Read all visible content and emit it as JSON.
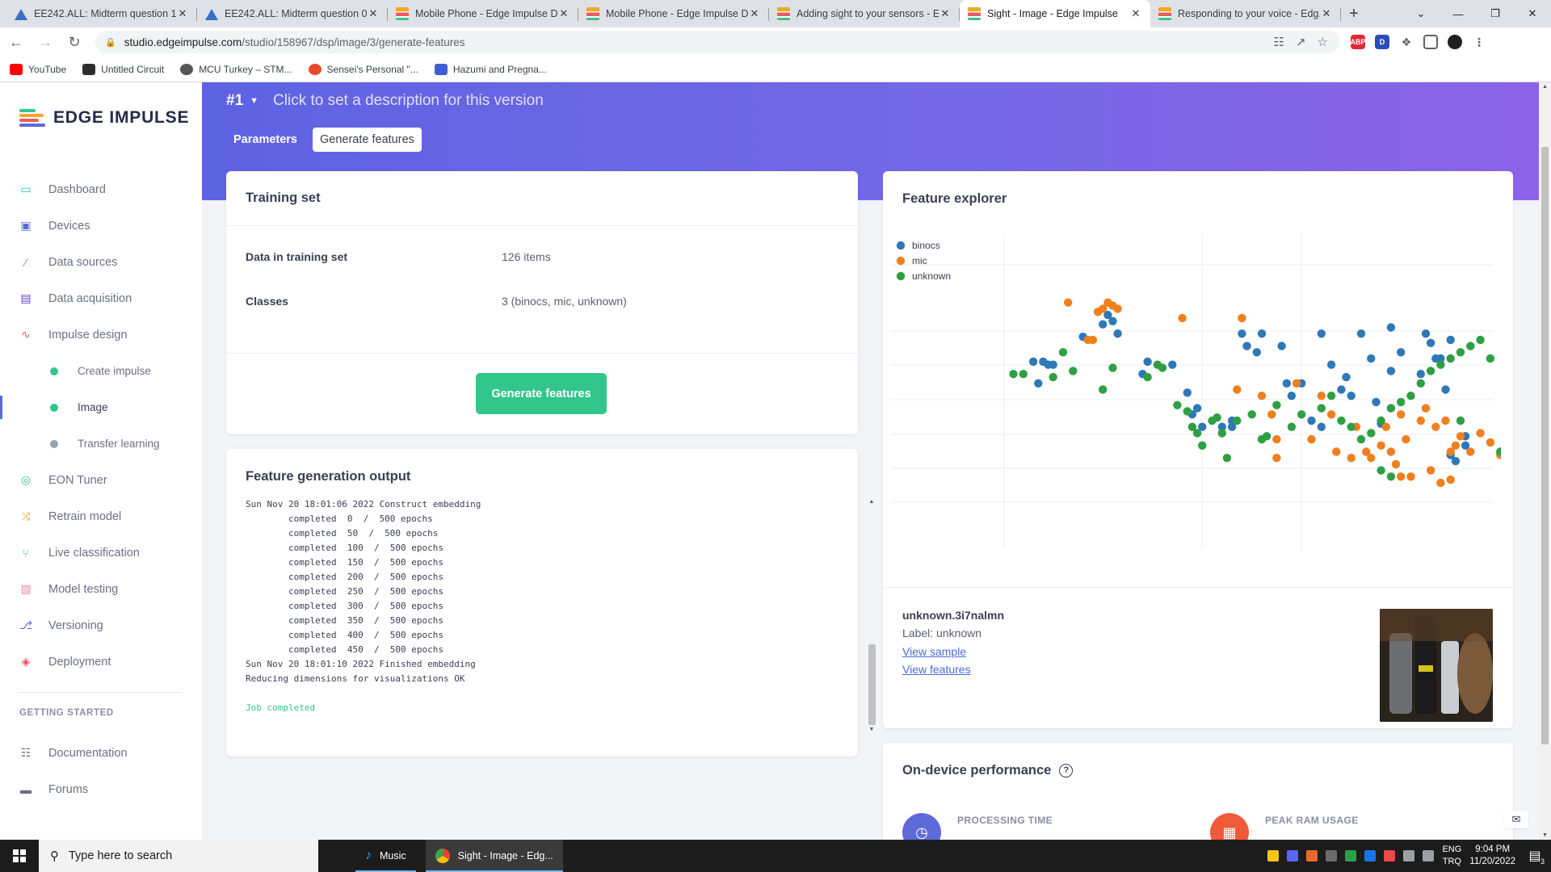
{
  "browser": {
    "tabs": [
      {
        "title": "EE242.ALL: Midterm question 1",
        "icon": "triangle-icon"
      },
      {
        "title": "EE242.ALL: Midterm question 0...",
        "icon": "triangle-icon"
      },
      {
        "title": "Mobile Phone - Edge Impulse D...",
        "icon": "edge-impulse-icon"
      },
      {
        "title": "Mobile Phone - Edge Impulse D...",
        "icon": "edge-impulse-icon"
      },
      {
        "title": "Adding sight to your sensors - E...",
        "icon": "edge-impulse-icon"
      },
      {
        "title": "Sight - Image - Edge Impulse",
        "icon": "edge-impulse-icon",
        "active": true
      },
      {
        "title": "Responding to your voice - Edg...",
        "icon": "edge-impulse-icon"
      }
    ],
    "url_host": "studio.edgeimpulse.com",
    "url_path": "/studio/158967/dsp/image/3/generate-features",
    "bookmarks": [
      "YouTube",
      "Untitled Circuit",
      "MCU Turkey – STM...",
      "Sensei's Personal \"...",
      "Hazumi and Pregna..."
    ]
  },
  "sidebar": {
    "logo": "EDGE IMPULSE",
    "items": [
      {
        "label": "Dashboard",
        "icon": "monitor-icon",
        "color": "#29b6d8"
      },
      {
        "label": "Devices",
        "icon": "chip-icon",
        "color": "#5c6bd8"
      },
      {
        "label": "Data sources",
        "icon": "wand-icon",
        "color": "#ef5a7a"
      },
      {
        "label": "Data acquisition",
        "icon": "database-icon",
        "color": "#5b3fc4"
      },
      {
        "label": "Impulse design",
        "icon": "pulse-icon",
        "color": "#ef5a5a"
      }
    ],
    "subitems": [
      {
        "label": "Create impulse",
        "color": "#32c68a"
      },
      {
        "label": "Image",
        "color": "#32c68a",
        "active": true
      },
      {
        "label": "Transfer learning",
        "color": "#9aa0ad"
      }
    ],
    "items2": [
      {
        "label": "EON Tuner",
        "icon": "target-icon",
        "color": "#32c68a"
      },
      {
        "label": "Retrain model",
        "icon": "shuffle-icon",
        "color": "#f5a623"
      },
      {
        "label": "Live classification",
        "icon": "tree-icon",
        "color": "#32c68a"
      },
      {
        "label": "Model testing",
        "icon": "clipboard-icon",
        "color": "#ef8a9a"
      },
      {
        "label": "Versioning",
        "icon": "branch-icon",
        "color": "#5c6bd8"
      },
      {
        "label": "Deployment",
        "icon": "box-icon",
        "color": "#ef4a5a"
      }
    ],
    "section_label": "GETTING STARTED",
    "bottom": [
      {
        "label": "Documentation",
        "icon": "book-icon"
      },
      {
        "label": "Forums",
        "icon": "chat-icon"
      }
    ]
  },
  "header": {
    "version": "#1",
    "description": "Click to set a description for this version",
    "tabs": [
      {
        "label": "Parameters",
        "active": false
      },
      {
        "label": "Generate features",
        "active": true
      }
    ]
  },
  "training_set": {
    "title": "Training set",
    "rows": [
      {
        "key": "Data in training set",
        "value": "126 items"
      },
      {
        "key": "Classes",
        "value": "3 (binocs, mic, unknown)"
      }
    ],
    "button": "Generate features"
  },
  "output": {
    "title": "Feature generation output",
    "lines": [
      "Sun Nov 20 18:01:06 2022 Construct embedding",
      "        completed  0  /  500 epochs",
      "        completed  50  /  500 epochs",
      "        completed  100  /  500 epochs",
      "        completed  150  /  500 epochs",
      "        completed  200  /  500 epochs",
      "        completed  250  /  500 epochs",
      "        completed  300  /  500 epochs",
      "        completed  350  /  500 epochs",
      "        completed  400  /  500 epochs",
      "        completed  450  /  500 epochs",
      "Sun Nov 20 18:01:10 2022 Finished embedding",
      "Reducing dimensions for visualizations OK",
      "",
      "Job completed"
    ]
  },
  "explorer": {
    "title": "Feature explorer",
    "sample_name": "unknown.3i7nalmn",
    "sample_label": "Label: unknown",
    "view_sample": "View sample",
    "view_features": "View features"
  },
  "chart_data": {
    "type": "scatter",
    "title": "",
    "xlabel": "",
    "ylabel": "",
    "grid": true,
    "legend": "top-left",
    "xlim": [
      0,
      100
    ],
    "ylim": [
      0,
      100
    ],
    "series": [
      {
        "name": "binocs",
        "color": "#2e78b7",
        "points": [
          [
            15,
            52
          ],
          [
            17,
            58
          ],
          [
            14,
            59
          ],
          [
            16,
            59
          ],
          [
            18,
            58
          ],
          [
            24,
            67
          ],
          [
            28,
            71
          ],
          [
            30,
            72
          ],
          [
            31,
            68
          ],
          [
            29,
            74
          ],
          [
            36,
            55
          ],
          [
            37,
            59
          ],
          [
            42,
            58
          ],
          [
            45,
            49
          ],
          [
            46,
            42
          ],
          [
            47,
            44
          ],
          [
            48,
            38
          ],
          [
            52,
            38
          ],
          [
            54,
            38
          ],
          [
            54,
            40
          ],
          [
            56,
            68
          ],
          [
            57,
            64
          ],
          [
            59,
            62
          ],
          [
            60,
            68
          ],
          [
            64,
            64
          ],
          [
            65,
            52
          ],
          [
            66,
            48
          ],
          [
            68,
            52
          ],
          [
            70,
            40
          ],
          [
            72,
            38
          ],
          [
            72,
            68
          ],
          [
            74,
            58
          ],
          [
            76,
            50
          ],
          [
            77,
            54
          ],
          [
            78,
            48
          ],
          [
            80,
            68
          ],
          [
            82,
            60
          ],
          [
            83,
            46
          ],
          [
            84,
            39
          ],
          [
            86,
            70
          ],
          [
            86,
            56
          ],
          [
            88,
            62
          ],
          [
            92,
            55
          ],
          [
            93,
            68
          ],
          [
            94,
            65
          ],
          [
            95,
            60
          ],
          [
            96,
            60
          ],
          [
            97,
            50
          ],
          [
            98,
            66
          ],
          [
            98,
            29
          ],
          [
            99,
            27
          ],
          [
            101,
            32
          ],
          [
            101,
            35
          ]
        ]
      },
      {
        "name": "mic",
        "color": "#f07f1e",
        "points": [
          [
            27,
            75
          ],
          [
            28,
            76
          ],
          [
            30,
            77
          ],
          [
            31,
            76
          ],
          [
            29,
            78
          ],
          [
            21,
            78
          ],
          [
            25,
            66
          ],
          [
            26,
            66
          ],
          [
            44,
            73
          ],
          [
            56,
            73
          ],
          [
            55,
            50
          ],
          [
            60,
            48
          ],
          [
            62,
            42
          ],
          [
            63,
            34
          ],
          [
            63,
            28
          ],
          [
            67,
            52
          ],
          [
            70,
            34
          ],
          [
            72,
            48
          ],
          [
            74,
            42
          ],
          [
            75,
            30
          ],
          [
            78,
            28
          ],
          [
            79,
            38
          ],
          [
            81,
            30
          ],
          [
            82,
            28
          ],
          [
            84,
            32
          ],
          [
            85,
            38
          ],
          [
            86,
            30
          ],
          [
            87,
            26
          ],
          [
            88,
            42
          ],
          [
            89,
            34
          ],
          [
            92,
            40
          ],
          [
            93,
            44
          ],
          [
            95,
            38
          ],
          [
            97,
            40
          ],
          [
            98,
            30
          ],
          [
            99,
            32
          ],
          [
            100,
            35
          ],
          [
            102,
            30
          ],
          [
            104,
            36
          ],
          [
            106,
            33
          ],
          [
            108,
            29
          ],
          [
            109,
            26
          ],
          [
            88,
            22
          ],
          [
            90,
            22
          ],
          [
            94,
            24
          ],
          [
            96,
            20
          ],
          [
            98,
            21
          ]
        ]
      },
      {
        "name": "unknown",
        "color": "#2ea043",
        "points": [
          [
            10,
            55
          ],
          [
            12,
            55
          ],
          [
            18,
            54
          ],
          [
            20,
            62
          ],
          [
            22,
            56
          ],
          [
            28,
            50
          ],
          [
            30,
            57
          ],
          [
            37,
            54
          ],
          [
            39,
            58
          ],
          [
            40,
            57
          ],
          [
            43,
            45
          ],
          [
            45,
            43
          ],
          [
            46,
            38
          ],
          [
            47,
            36
          ],
          [
            48,
            32
          ],
          [
            50,
            40
          ],
          [
            51,
            41
          ],
          [
            52,
            36
          ],
          [
            53,
            28
          ],
          [
            55,
            40
          ],
          [
            58,
            42
          ],
          [
            60,
            34
          ],
          [
            61,
            35
          ],
          [
            63,
            45
          ],
          [
            66,
            38
          ],
          [
            68,
            42
          ],
          [
            72,
            44
          ],
          [
            74,
            48
          ],
          [
            76,
            40
          ],
          [
            78,
            38
          ],
          [
            80,
            34
          ],
          [
            82,
            36
          ],
          [
            84,
            40
          ],
          [
            86,
            44
          ],
          [
            88,
            46
          ],
          [
            90,
            48
          ],
          [
            92,
            52
          ],
          [
            94,
            56
          ],
          [
            96,
            58
          ],
          [
            98,
            60
          ],
          [
            100,
            62
          ],
          [
            102,
            64
          ],
          [
            104,
            66
          ],
          [
            106,
            60
          ],
          [
            108,
            30
          ],
          [
            110,
            28
          ],
          [
            112,
            26
          ],
          [
            100,
            40
          ],
          [
            84,
            24
          ],
          [
            86,
            22
          ]
        ]
      }
    ]
  },
  "performance": {
    "title": "On-device performance",
    "metrics": [
      {
        "label": "PROCESSING TIME",
        "icon": "clock-icon",
        "color": "#5c6bd8"
      },
      {
        "label": "PEAK RAM USAGE",
        "icon": "memory-icon",
        "color": "#ef5a3a"
      }
    ]
  },
  "taskbar": {
    "search_placeholder": "Type here to search",
    "apps": [
      {
        "label": "Music",
        "active": false
      },
      {
        "label": "Sight - Image - Edg...",
        "active": true
      }
    ],
    "lang_1": "ENG",
    "lang_2": "TRQ",
    "time": "9:04 PM",
    "date": "11/20/2022",
    "notifications": "3"
  }
}
